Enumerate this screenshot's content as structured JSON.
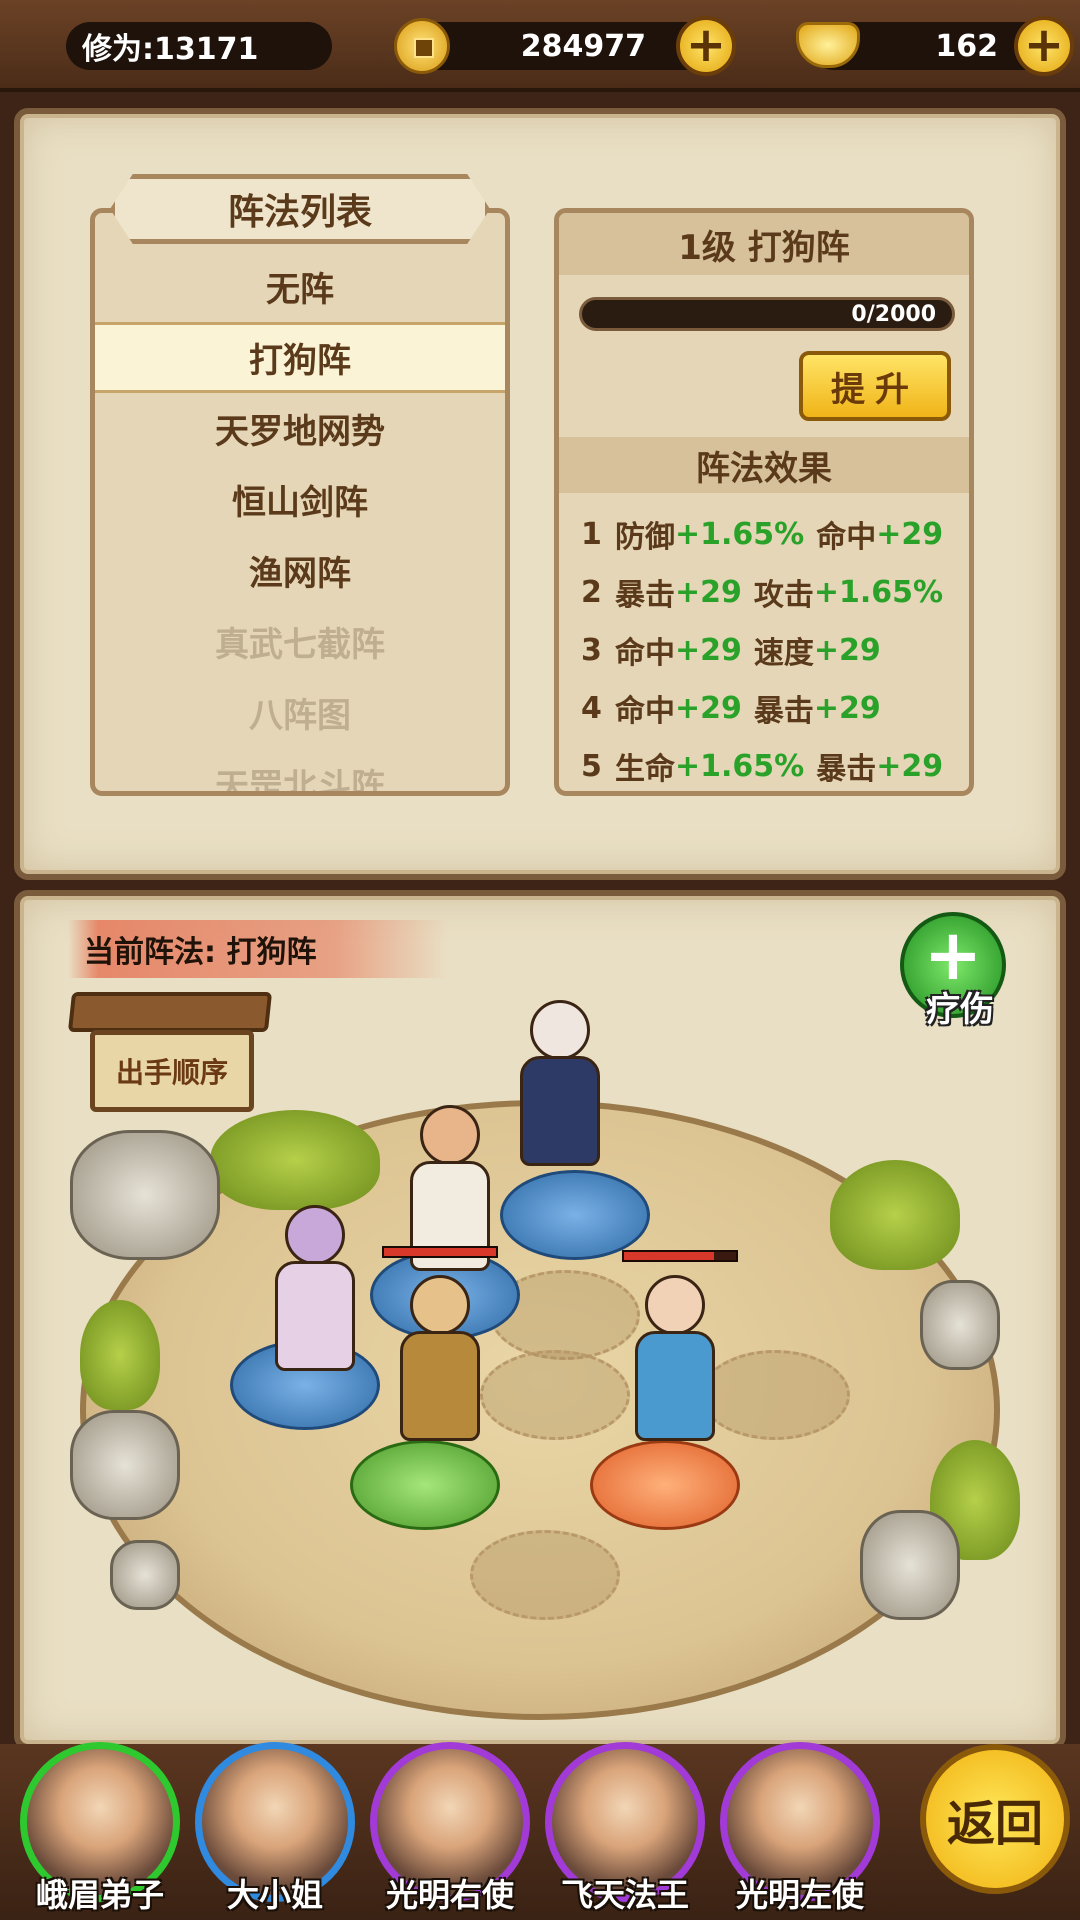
{
  "topbar": {
    "cultivation": "修为:13171",
    "coins": "284977",
    "gold": "162"
  },
  "formation_list": {
    "title": "阵法列表",
    "items": [
      {
        "label": "无阵",
        "state": "normal"
      },
      {
        "label": "打狗阵",
        "state": "selected"
      },
      {
        "label": "天罗地网势",
        "state": "normal"
      },
      {
        "label": "恒山剑阵",
        "state": "normal"
      },
      {
        "label": "渔网阵",
        "state": "normal"
      },
      {
        "label": "真武七截阵",
        "state": "locked"
      },
      {
        "label": "八阵图",
        "state": "locked"
      },
      {
        "label": "天罡北斗阵",
        "state": "locked"
      }
    ]
  },
  "detail": {
    "header": "1级 打狗阵",
    "progress_text": "0/2000",
    "progress_fraction": 0,
    "upgrade_label": "提升",
    "effects_title": "阵法效果",
    "effects": [
      {
        "num": "1",
        "parts": [
          {
            "stat": "防御",
            "val": "+1.65%"
          },
          {
            "stat": "命中",
            "val": "+29"
          }
        ]
      },
      {
        "num": "2",
        "parts": [
          {
            "stat": "暴击",
            "val": "+29"
          },
          {
            "stat": "攻击",
            "val": "+1.65%"
          }
        ]
      },
      {
        "num": "3",
        "parts": [
          {
            "stat": "命中",
            "val": "+29"
          },
          {
            "stat": "速度",
            "val": "+29"
          }
        ]
      },
      {
        "num": "4",
        "parts": [
          {
            "stat": "命中",
            "val": "+29"
          },
          {
            "stat": "暴击",
            "val": "+29"
          }
        ]
      },
      {
        "num": "5",
        "parts": [
          {
            "stat": "生命",
            "val": "+1.65%"
          },
          {
            "stat": "暴击",
            "val": "+29"
          }
        ]
      }
    ]
  },
  "battlefield": {
    "current_formation": "当前阵法: 打狗阵",
    "heal_label": "疗伤",
    "sign_label": "出手顺序"
  },
  "roster": [
    {
      "name": "峨眉弟子",
      "ring": "green"
    },
    {
      "name": "大小姐",
      "ring": "blue"
    },
    {
      "name": "光明右使",
      "ring": "purple"
    },
    {
      "name": "飞天法王",
      "ring": "purple"
    },
    {
      "name": "光明左使",
      "ring": "purple"
    }
  ],
  "back_label": "返回",
  "colors": {
    "bonus_green": "#2aa22a",
    "text_brown": "#5a3a1a",
    "locked_text": "#bfae90"
  }
}
